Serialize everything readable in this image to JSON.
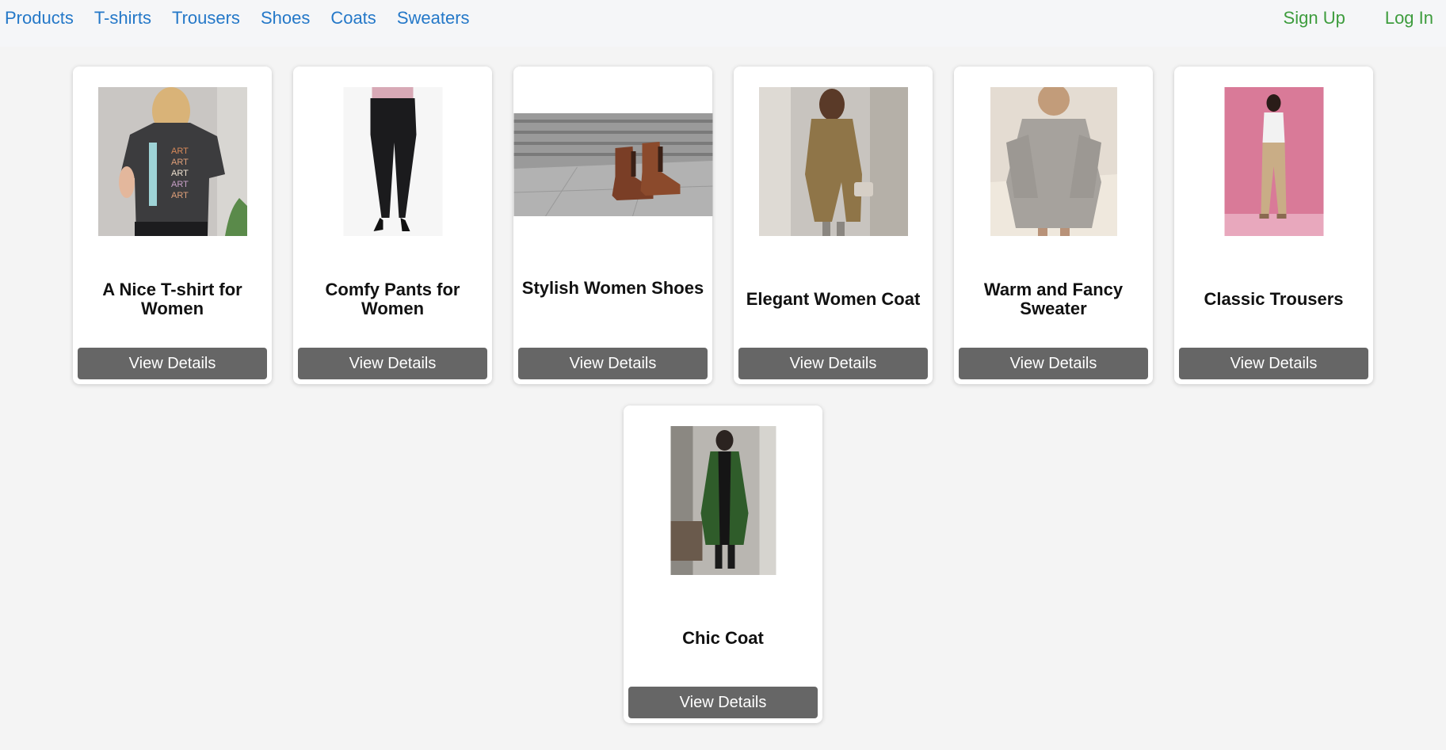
{
  "nav": {
    "links": [
      "Products",
      "T-shirts",
      "Trousers",
      "Shoes",
      "Coats",
      "Sweaters"
    ],
    "sign_up": "Sign Up",
    "log_in": "Log In",
    "link_color": "#2478c8",
    "auth_color": "#3d9c3d"
  },
  "products": [
    {
      "title": "A Nice T-shirt for Women",
      "button": "View Details",
      "image": "grey-tshirt-photo"
    },
    {
      "title": "Comfy Pants for Women",
      "button": "View Details",
      "image": "black-pants-photo"
    },
    {
      "title": "Stylish Women Shoes",
      "button": "View Details",
      "image": "brown-boots-photo"
    },
    {
      "title": "Elegant Women Coat",
      "button": "View Details",
      "image": "camel-coat-photo"
    },
    {
      "title": "Warm and Fancy Sweater",
      "button": "View Details",
      "image": "knit-sweater-photo"
    },
    {
      "title": "Classic Trousers",
      "button": "View Details",
      "image": "beige-trousers-photo"
    },
    {
      "title": "Chic Coat",
      "button": "View Details",
      "image": "green-coat-photo"
    }
  ]
}
